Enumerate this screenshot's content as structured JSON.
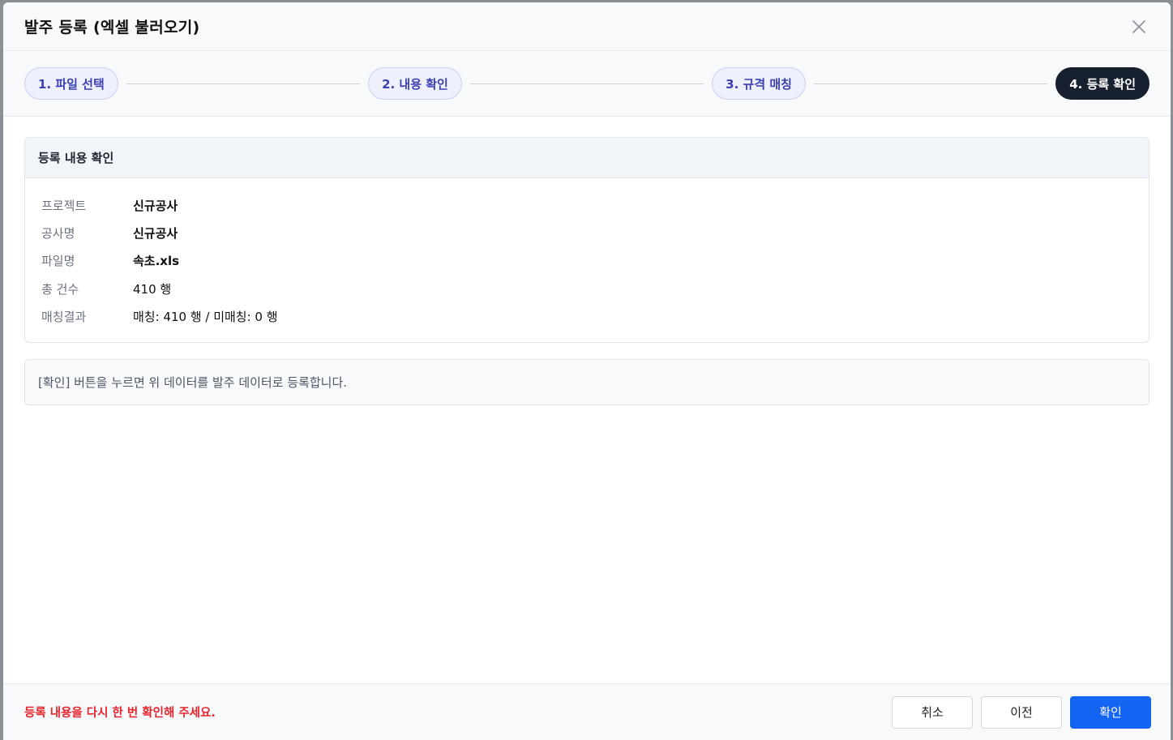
{
  "modal": {
    "title": "발주 등록 (엑셀 불러오기)",
    "close_icon": "close-icon"
  },
  "steps": [
    {
      "label": "1. 파일 선택",
      "active": false
    },
    {
      "label": "2. 내용 확인",
      "active": false
    },
    {
      "label": "3. 규격 매칭",
      "active": false
    },
    {
      "label": "4. 등록 확인",
      "active": true
    }
  ],
  "summary": {
    "heading": "등록 내용 확인",
    "rows": [
      {
        "label": "프로젝트",
        "value": "신규공사"
      },
      {
        "label": "공사명",
        "value": "신규공사"
      },
      {
        "label": "파일명",
        "value": "속초.xls"
      },
      {
        "label": "총 건수",
        "value": "410 행"
      },
      {
        "label": "매칭결과",
        "value": "매칭: 410 행 / 미매칭: 0 행"
      }
    ]
  },
  "notice": "[확인] 버튼을 누르면 위 데이터를 발주 데이터로 등록합니다.",
  "footer": {
    "warning": "등록 내용을 다시 한 번 확인해 주세요.",
    "cancel_label": "취소",
    "prev_label": "이전",
    "confirm_label": "확인"
  },
  "colors": {
    "primary": "#1565f5",
    "active_step": "#17202e",
    "warning": "#e5242b",
    "step_text": "#3b3fb0"
  }
}
